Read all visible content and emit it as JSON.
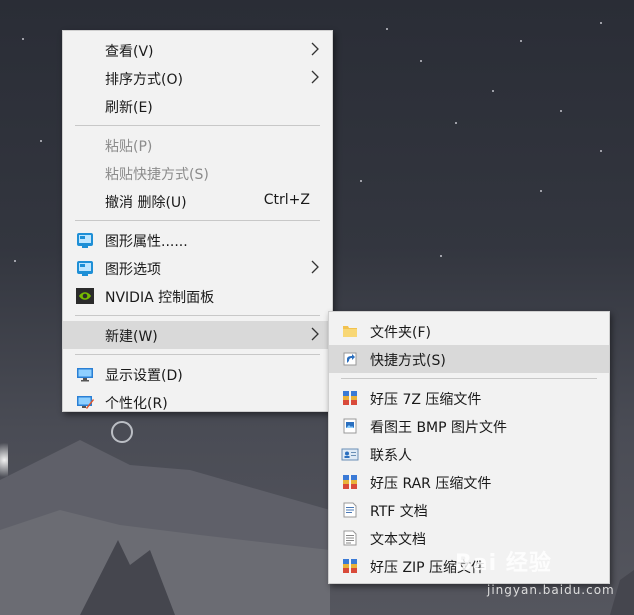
{
  "main_menu": {
    "view": "查看(V)",
    "sort": "排序方式(O)",
    "refresh": "刷新(E)",
    "paste": "粘贴(P)",
    "paste_shortcut": "粘贴快捷方式(S)",
    "undo": "撤消 删除(U)",
    "undo_shortcut": "Ctrl+Z",
    "graphics_properties": "图形属性......",
    "graphics_options": "图形选项",
    "nvidia": "NVIDIA 控制面板",
    "new": "新建(W)",
    "display_settings": "显示设置(D)",
    "personalize": "个性化(R)"
  },
  "new_submenu": {
    "folder": "文件夹(F)",
    "shortcut": "快捷方式(S)",
    "zip7z": "好压 7Z 压缩文件",
    "bmp": "看图王 BMP 图片文件",
    "contact": "联系人",
    "rar": "好压 RAR 压缩文件",
    "rtf": "RTF 文档",
    "txt": "文本文档",
    "zip": "好压 ZIP 压缩文件"
  },
  "watermark": {
    "brand": "Bai 经验",
    "url": "jingyan.baidu.com"
  },
  "colors": {
    "menu_bg": "#f2f2f2",
    "highlight": "#d9d9d9",
    "disabled_text": "#8c8c8c"
  }
}
